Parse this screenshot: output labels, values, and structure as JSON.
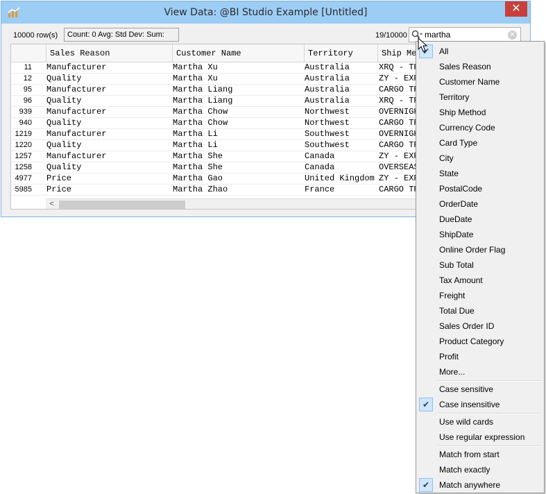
{
  "window": {
    "title": "View Data: @BI Studio Example [Untitled]",
    "close_label": "✕"
  },
  "toolbar": {
    "row_count": "10000 row(s)",
    "stats": "Count: 0  Avg:   Std Dev:   Sum:",
    "match_count": "19/10000",
    "search_value": "martha"
  },
  "grid": {
    "columns": [
      "Sales Reason",
      "Customer Name",
      "Territory",
      "Ship Me"
    ],
    "rows": [
      {
        "id": "11",
        "reason": "Manufacturer",
        "name": "Martha Xu",
        "territory": "Australia",
        "ship": "XRQ - TR"
      },
      {
        "id": "12",
        "reason": "Quality",
        "name": "Martha Xu",
        "territory": "Australia",
        "ship": "ZY - EXP"
      },
      {
        "id": "95",
        "reason": "Manufacturer",
        "name": "Martha Liang",
        "territory": "Australia",
        "ship": "CARGO TR"
      },
      {
        "id": "96",
        "reason": "Quality",
        "name": "Martha Liang",
        "territory": "Australia",
        "ship": "XRQ - TR"
      },
      {
        "id": "939",
        "reason": "Manufacturer",
        "name": "Martha Chow",
        "territory": "Northwest",
        "ship": "OVERNIGH"
      },
      {
        "id": "940",
        "reason": "Quality",
        "name": "Martha Chow",
        "territory": "Northwest",
        "ship": "CARGO TR"
      },
      {
        "id": "1219",
        "reason": "Manufacturer",
        "name": "Martha Li",
        "territory": "Southwest",
        "ship": "OVERNIGH"
      },
      {
        "id": "1220",
        "reason": "Quality",
        "name": "Martha Li",
        "territory": "Southwest",
        "ship": "CARGO TR"
      },
      {
        "id": "1257",
        "reason": "Manufacturer",
        "name": "Martha She",
        "territory": "Canada",
        "ship": "ZY - EXP"
      },
      {
        "id": "1258",
        "reason": "Quality",
        "name": "Martha She",
        "territory": "Canada",
        "ship": "OVERSEAS"
      },
      {
        "id": "4977",
        "reason": "Price",
        "name": "Martha Gao",
        "territory": "United Kingdom",
        "ship": "ZY - EXP"
      },
      {
        "id": "5985",
        "reason": "Price",
        "name": "Martha Zhao",
        "territory": "France",
        "ship": "CARGO TR"
      }
    ],
    "scroll_left_label": "<"
  },
  "menu": {
    "check_mark": "✔",
    "groups": [
      [
        {
          "label": "All",
          "checked": true
        },
        {
          "label": "Sales Reason"
        },
        {
          "label": "Customer Name"
        },
        {
          "label": "Territory"
        },
        {
          "label": "Ship Method"
        },
        {
          "label": "Currency Code"
        },
        {
          "label": "Card Type"
        },
        {
          "label": "City"
        },
        {
          "label": "State"
        },
        {
          "label": "PostalCode"
        },
        {
          "label": "OrderDate"
        },
        {
          "label": "DueDate"
        },
        {
          "label": "ShipDate"
        },
        {
          "label": "Online Order Flag"
        },
        {
          "label": "Sub Total"
        },
        {
          "label": "Tax Amount"
        },
        {
          "label": "Freight"
        },
        {
          "label": "Total Due"
        },
        {
          "label": "Sales Order ID"
        },
        {
          "label": "Product Category"
        },
        {
          "label": "Profit"
        },
        {
          "label": "More..."
        }
      ],
      [
        {
          "label": "Case sensitive"
        },
        {
          "label": "Case insensitive",
          "checked": true
        }
      ],
      [
        {
          "label": "Use wild cards"
        },
        {
          "label": "Use regular expression"
        }
      ],
      [
        {
          "label": "Match from start"
        },
        {
          "label": "Match exactly"
        },
        {
          "label": "Match anywhere",
          "checked": true
        }
      ]
    ]
  },
  "colors": {
    "titlebar": "#9ccdf5",
    "close": "#c7413a",
    "check_bg": "#cfe6fb"
  }
}
